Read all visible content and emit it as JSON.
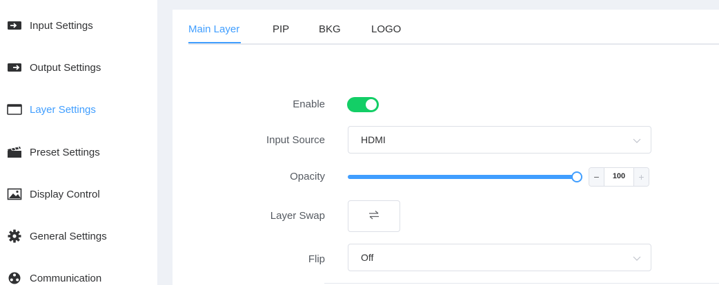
{
  "sidebar": {
    "items": [
      {
        "label": "Input Settings",
        "icon": "input-icon",
        "active": false
      },
      {
        "label": "Output Settings",
        "icon": "output-icon",
        "active": false
      },
      {
        "label": "Layer Settings",
        "icon": "layer-window-icon",
        "active": true
      },
      {
        "label": "Preset Settings",
        "icon": "clapperboard-icon",
        "active": false
      },
      {
        "label": "Display Control",
        "icon": "image-icon",
        "active": false
      },
      {
        "label": "General Settings",
        "icon": "gear-icon",
        "active": false
      },
      {
        "label": "Communication",
        "icon": "network-icon",
        "active": false
      }
    ]
  },
  "tabs": [
    {
      "label": "Main Layer",
      "active": true
    },
    {
      "label": "PIP",
      "active": false
    },
    {
      "label": "BKG",
      "active": false
    },
    {
      "label": "LOGO",
      "active": false
    }
  ],
  "form": {
    "enable": {
      "label": "Enable",
      "value": true
    },
    "input_source": {
      "label": "Input Source",
      "value": "HDMI"
    },
    "opacity": {
      "label": "Opacity",
      "value": "100",
      "level": 1.0
    },
    "layer_swap": {
      "label": "Layer Swap",
      "icon": "swap-arrows-icon"
    },
    "flip": {
      "label": "Flip",
      "value": "Off"
    }
  },
  "colors": {
    "accent": "#409eff",
    "switch_on": "#13ce66",
    "text": "#303133",
    "gutter": "#eef1f6"
  }
}
